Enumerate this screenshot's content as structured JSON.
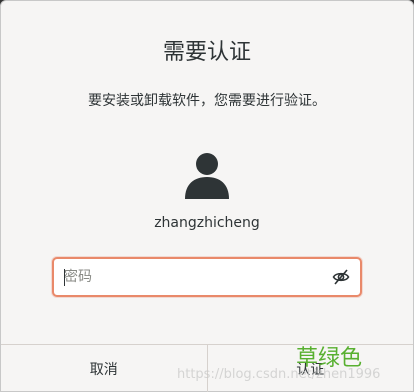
{
  "dialog": {
    "title": "需要认证",
    "message": "要安装或卸载软件，您需要进行验证。",
    "username": "zhangzhicheng",
    "password": {
      "value": "",
      "placeholder": "密码"
    },
    "buttons": {
      "cancel": "取消",
      "confirm": "认证"
    }
  },
  "icons": {
    "avatar": "user-avatar-icon",
    "reveal_password": "eye-slash-icon"
  },
  "colors": {
    "focus_border": "#e9896a",
    "annotation_text": "#58b030"
  },
  "overlay": {
    "annotation": "草绿色",
    "watermark": "https://blog.csdn.net/zhen1996"
  }
}
